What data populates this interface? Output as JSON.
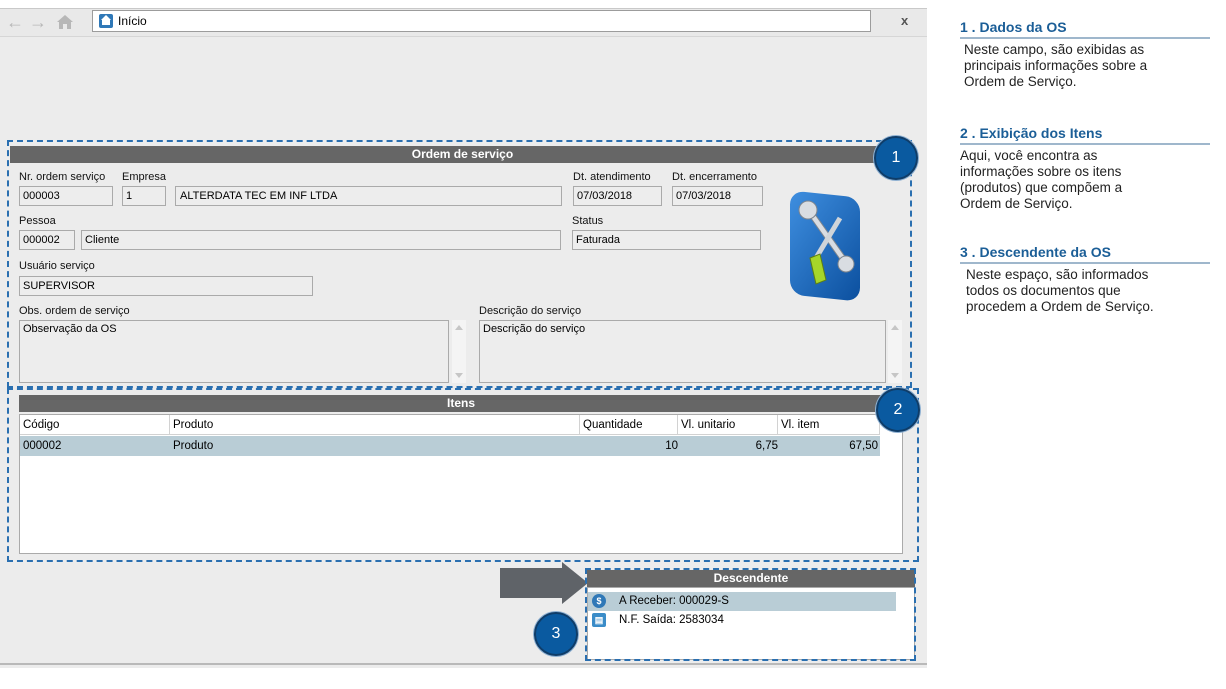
{
  "nav": {
    "back_icon": "back-arrow-icon",
    "forward_icon": "forward-arrow-icon",
    "home_icon": "home-icon",
    "address_text": "Início",
    "close_label": "x"
  },
  "os_panel": {
    "title": "Ordem de serviço",
    "labels": {
      "nr_ordem": "Nr. ordem serviço",
      "empresa": "Empresa",
      "dt_atendimento": "Dt. atendimento",
      "dt_encerramento": "Dt. encerramento",
      "pessoa": "Pessoa",
      "status": "Status",
      "usuario": "Usuário serviço",
      "obs": "Obs. ordem de serviço",
      "descricao": "Descrição do serviço"
    },
    "values": {
      "nr_ordem": "000003",
      "empresa_code": "1",
      "empresa_name": "ALTERDATA TEC EM INF LTDA",
      "dt_atendimento": "07/03/2018",
      "dt_encerramento": "07/03/2018",
      "pessoa_code": "000002",
      "pessoa_name": "Cliente",
      "status": "Faturada",
      "usuario": "SUPERVISOR",
      "obs": "Observação da OS",
      "descricao": "Descrição do serviço"
    }
  },
  "itens_panel": {
    "title": "Itens",
    "columns": [
      "Código",
      "Produto",
      "Quantidade",
      "Vl. unitario",
      "Vl. item"
    ],
    "rows": [
      {
        "codigo": "000002",
        "produto": "Produto",
        "quantidade": "10",
        "vl_unitario": "6,75",
        "vl_item": "67,50"
      }
    ]
  },
  "descendente_panel": {
    "title": "Descendente",
    "items": [
      {
        "label": "A Receber: 000029-S",
        "icon": "money-icon"
      },
      {
        "label": "N.F. Saída: 2583034",
        "icon": "invoice-icon"
      }
    ]
  },
  "badges": [
    "1",
    "2",
    "3"
  ],
  "help": [
    {
      "title": "1 . Dados da OS",
      "body": "Neste campo, são exibidas as\nprincipais informações sobre a\nOrdem de Serviço."
    },
    {
      "title": "2 . Exibição dos Itens",
      "body": "Aqui, você encontra as\ninformações sobre os itens\n (produtos) que compõem a\nOrdem de Serviço."
    },
    {
      "title": "3 . Descendente da OS",
      "body": "Neste espaço, são informados\ntodos os documentos que\nprocedem a Ordem de Serviço."
    }
  ],
  "colors": {
    "accent": "#0a5aa0",
    "header_bg": "#666666",
    "selected_row": "#b9cdd6",
    "dash": "#2a6fb0"
  }
}
